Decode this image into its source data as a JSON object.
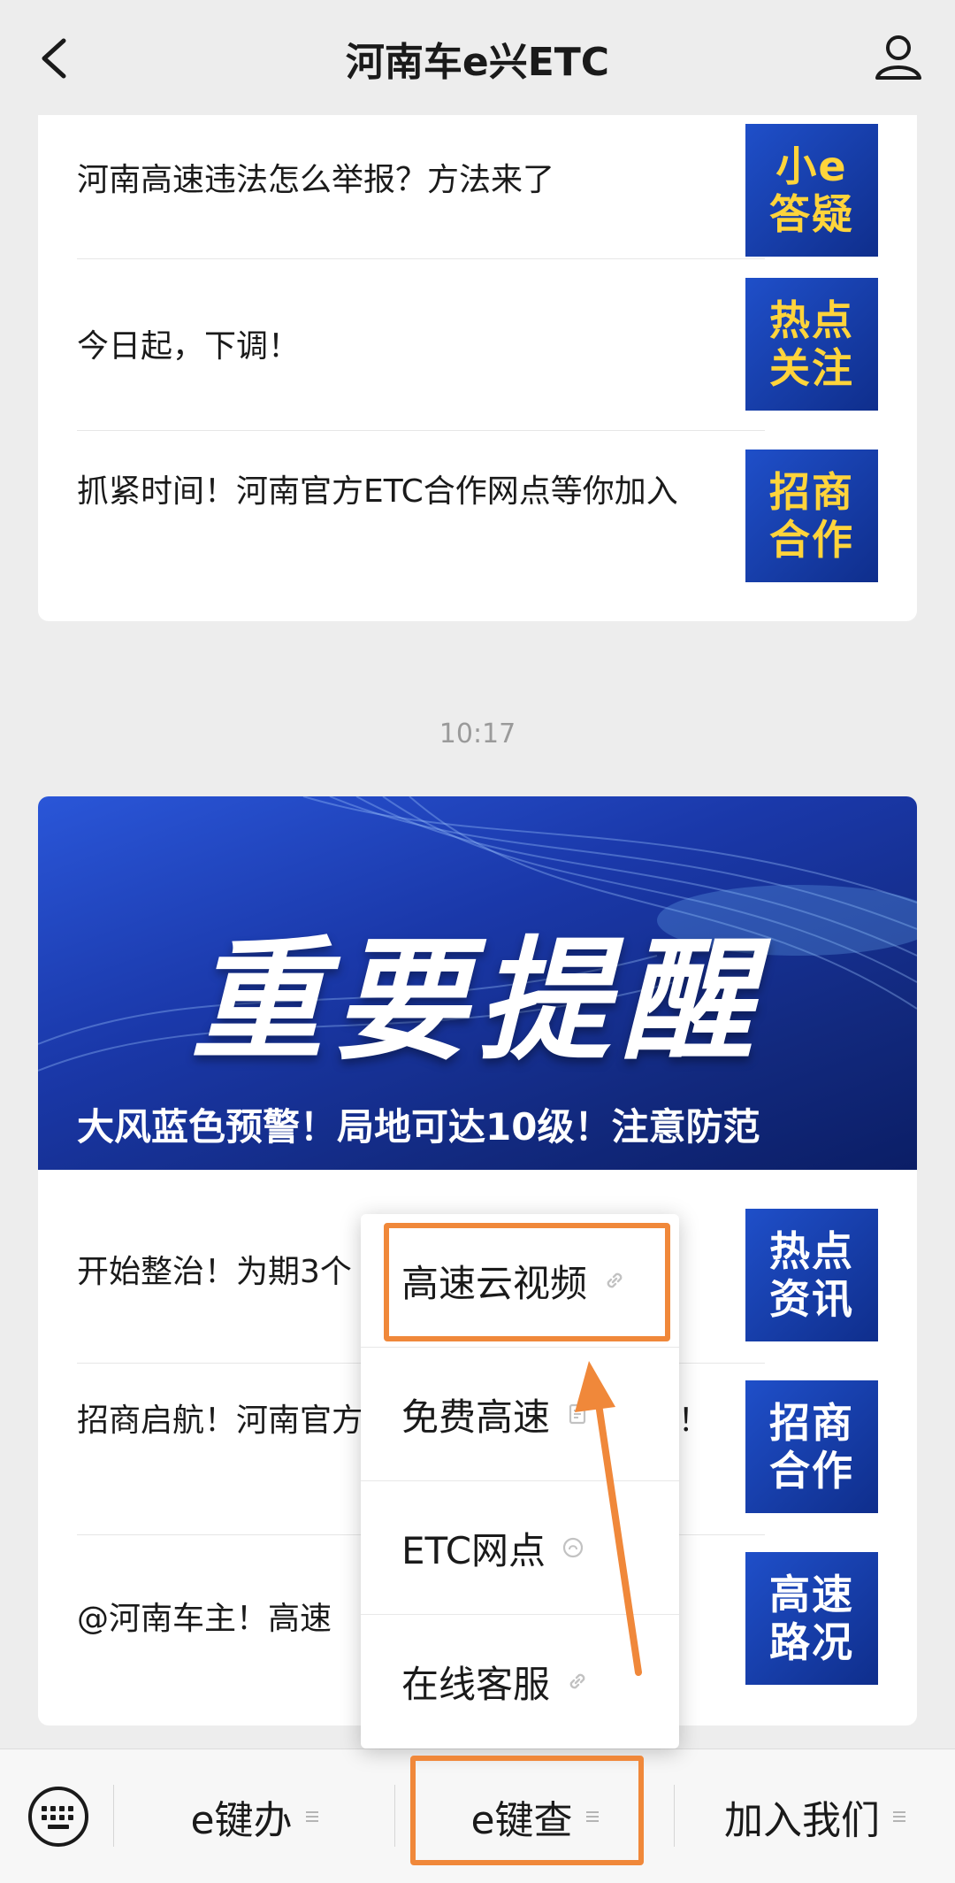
{
  "header": {
    "title": "河南车e兴ETC"
  },
  "articles_top": [
    {
      "title": "河南高速违法怎么举报？方法来了",
      "thumb_lines": [
        "小e",
        "答疑"
      ],
      "thumb_style": "yellow"
    },
    {
      "title": "今日起，下调！",
      "thumb_lines": [
        "热点",
        "关注"
      ],
      "thumb_style": "yellow"
    },
    {
      "title": "抓紧时间！河南官方ETC合作网点等你加入",
      "thumb_lines": [
        "招商",
        "合作"
      ],
      "thumb_style": "yellow"
    }
  ],
  "timestamp": "10:17",
  "banner": {
    "headline": "重要提醒",
    "caption": "大风蓝色预警！局地可达10级！注意防范"
  },
  "articles_bottom": [
    {
      "title": "开始整治！为期3个",
      "thumb_lines": [
        "热点",
        "资讯"
      ],
      "thumb_style": "white"
    },
    {
      "title": "招商启航！河南官方ETC合作网点正式启动！",
      "thumb_lines": [
        "招商",
        "合作"
      ],
      "thumb_style": "white"
    },
    {
      "title": "@河南车主！高速",
      "thumb_lines": [
        "高速",
        "路况"
      ],
      "thumb_style": "white"
    }
  ],
  "popup_menu": {
    "items": [
      {
        "label": "高速云视频",
        "icon": "link-icon"
      },
      {
        "label": "免费高速",
        "icon": "article-icon"
      },
      {
        "label": "ETC网点",
        "icon": "miniprogram-icon"
      },
      {
        "label": "在线客服",
        "icon": "link-icon"
      }
    ]
  },
  "bottom_menu": {
    "tabs": [
      {
        "label": "e键办"
      },
      {
        "label": "e键查"
      },
      {
        "label": "加入我们"
      }
    ]
  },
  "colors": {
    "highlight": "#f0883a",
    "thumb_bg": "#1a3fb0",
    "thumb_text_yellow": "#ffd43b"
  }
}
